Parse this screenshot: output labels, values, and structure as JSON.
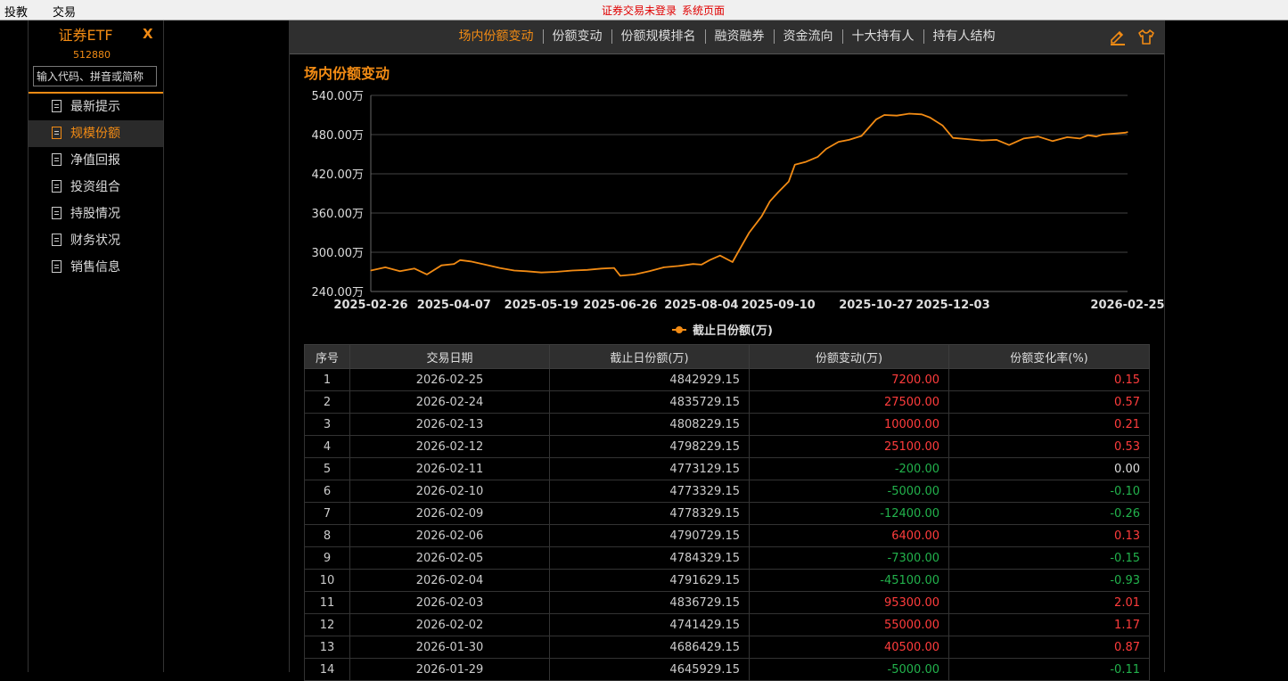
{
  "topbar": {
    "menus": [
      "投教",
      "交易"
    ],
    "status_login": "证券交易未登录",
    "status_page": "系统页面"
  },
  "sidebar": {
    "fund_name": "证券ETF",
    "close_label": "X",
    "fund_code": "512880",
    "search_placeholder": "输入代码、拼音或简称",
    "items": [
      {
        "label": "最新提示",
        "active": false
      },
      {
        "label": "规模份额",
        "active": true
      },
      {
        "label": "净值回报",
        "active": false
      },
      {
        "label": "投资组合",
        "active": false
      },
      {
        "label": "持股情况",
        "active": false
      },
      {
        "label": "财务状况",
        "active": false
      },
      {
        "label": "销售信息",
        "active": false
      }
    ]
  },
  "tabs": [
    {
      "label": "场内份额变动",
      "active": true
    },
    {
      "label": "份额变动",
      "active": false
    },
    {
      "label": "份额规模排名",
      "active": false
    },
    {
      "label": "融资融券",
      "active": false
    },
    {
      "label": "资金流向",
      "active": false
    },
    {
      "label": "十大持有人",
      "active": false
    },
    {
      "label": "持有人结构",
      "active": false
    }
  ],
  "section_title": "场内份额变动",
  "colors": {
    "accent": "#f28b14",
    "up": "#ff3c3c",
    "down": "#22b24c"
  },
  "chart_data": {
    "type": "line",
    "title": "",
    "ylim": [
      240,
      540
    ],
    "y_ticks": [
      "540.00万",
      "480.00万",
      "420.00万",
      "360.00万",
      "300.00万",
      "240.00万"
    ],
    "x_ticks": [
      "2025-02-26",
      "2025-04-07",
      "2025-05-19",
      "2025-06-26",
      "2025-08-04",
      "2025-09-10",
      "2025-10-27",
      "2025-12-03",
      "2026-02-25"
    ],
    "grid": true,
    "legend_position": "bottom",
    "series": [
      {
        "name": "截止日份额(万)",
        "color": "#f28b14",
        "points": [
          [
            "2025-02-26",
            272
          ],
          [
            "2025-03-05",
            277
          ],
          [
            "2025-03-12",
            271
          ],
          [
            "2025-03-19",
            275
          ],
          [
            "2025-03-25",
            266
          ],
          [
            "2025-04-01",
            280
          ],
          [
            "2025-04-07",
            282
          ],
          [
            "2025-04-10",
            288
          ],
          [
            "2025-04-15",
            286
          ],
          [
            "2025-04-22",
            281
          ],
          [
            "2025-04-29",
            276
          ],
          [
            "2025-05-06",
            272
          ],
          [
            "2025-05-12",
            271
          ],
          [
            "2025-05-19",
            269
          ],
          [
            "2025-05-26",
            270
          ],
          [
            "2025-06-03",
            272
          ],
          [
            "2025-06-10",
            273
          ],
          [
            "2025-06-17",
            275
          ],
          [
            "2025-06-23",
            276
          ],
          [
            "2025-06-26",
            264
          ],
          [
            "2025-07-03",
            266
          ],
          [
            "2025-07-10",
            271
          ],
          [
            "2025-07-17",
            277
          ],
          [
            "2025-07-24",
            279
          ],
          [
            "2025-07-31",
            282
          ],
          [
            "2025-08-04",
            281
          ],
          [
            "2025-08-08",
            288
          ],
          [
            "2025-08-13",
            295
          ],
          [
            "2025-08-19",
            285
          ],
          [
            "2025-08-22",
            302
          ],
          [
            "2025-08-27",
            330
          ],
          [
            "2025-09-02",
            355
          ],
          [
            "2025-09-06",
            378
          ],
          [
            "2025-09-10",
            392
          ],
          [
            "2025-09-15",
            408
          ],
          [
            "2025-09-18",
            434
          ],
          [
            "2025-09-23",
            438
          ],
          [
            "2025-09-29",
            446
          ],
          [
            "2025-10-03",
            458
          ],
          [
            "2025-10-09",
            469
          ],
          [
            "2025-10-14",
            472
          ],
          [
            "2025-10-20",
            478
          ],
          [
            "2025-10-27",
            503
          ],
          [
            "2025-10-31",
            510
          ],
          [
            "2025-11-06",
            509
          ],
          [
            "2025-11-12",
            512
          ],
          [
            "2025-11-18",
            511
          ],
          [
            "2025-11-22",
            506
          ],
          [
            "2025-11-28",
            494
          ],
          [
            "2025-12-03",
            475
          ],
          [
            "2025-12-10",
            473
          ],
          [
            "2025-12-17",
            471
          ],
          [
            "2025-12-24",
            472
          ],
          [
            "2025-12-30",
            464
          ],
          [
            "2026-01-06",
            474
          ],
          [
            "2026-01-13",
            477
          ],
          [
            "2026-01-20",
            470
          ],
          [
            "2026-01-27",
            476
          ],
          [
            "2026-02-02",
            474
          ],
          [
            "2026-02-06",
            479
          ],
          [
            "2026-02-10",
            477
          ],
          [
            "2026-02-12",
            479
          ],
          [
            "2026-02-13",
            480
          ],
          [
            "2026-02-24",
            483
          ],
          [
            "2026-02-25",
            484
          ]
        ]
      }
    ]
  },
  "table": {
    "headers": [
      "序号",
      "交易日期",
      "截止日份额(万)",
      "份额变动(万)",
      "份额变化率(%)"
    ],
    "rows": [
      {
        "no": "1",
        "date": "2026-02-25",
        "shares": "4842929.15",
        "change": "7200.00",
        "rate": "0.15",
        "dir": "up"
      },
      {
        "no": "2",
        "date": "2026-02-24",
        "shares": "4835729.15",
        "change": "27500.00",
        "rate": "0.57",
        "dir": "up"
      },
      {
        "no": "3",
        "date": "2026-02-13",
        "shares": "4808229.15",
        "change": "10000.00",
        "rate": "0.21",
        "dir": "up"
      },
      {
        "no": "4",
        "date": "2026-02-12",
        "shares": "4798229.15",
        "change": "25100.00",
        "rate": "0.53",
        "dir": "up"
      },
      {
        "no": "5",
        "date": "2026-02-11",
        "shares": "4773129.15",
        "change": "-200.00",
        "rate": "0.00",
        "dir": "down",
        "rate_dir": "flat"
      },
      {
        "no": "6",
        "date": "2026-02-10",
        "shares": "4773329.15",
        "change": "-5000.00",
        "rate": "-0.10",
        "dir": "down"
      },
      {
        "no": "7",
        "date": "2026-02-09",
        "shares": "4778329.15",
        "change": "-12400.00",
        "rate": "-0.26",
        "dir": "down"
      },
      {
        "no": "8",
        "date": "2026-02-06",
        "shares": "4790729.15",
        "change": "6400.00",
        "rate": "0.13",
        "dir": "up"
      },
      {
        "no": "9",
        "date": "2026-02-05",
        "shares": "4784329.15",
        "change": "-7300.00",
        "rate": "-0.15",
        "dir": "down"
      },
      {
        "no": "10",
        "date": "2026-02-04",
        "shares": "4791629.15",
        "change": "-45100.00",
        "rate": "-0.93",
        "dir": "down"
      },
      {
        "no": "11",
        "date": "2026-02-03",
        "shares": "4836729.15",
        "change": "95300.00",
        "rate": "2.01",
        "dir": "up"
      },
      {
        "no": "12",
        "date": "2026-02-02",
        "shares": "4741429.15",
        "change": "55000.00",
        "rate": "1.17",
        "dir": "up"
      },
      {
        "no": "13",
        "date": "2026-01-30",
        "shares": "4686429.15",
        "change": "40500.00",
        "rate": "0.87",
        "dir": "up"
      },
      {
        "no": "14",
        "date": "2026-01-29",
        "shares": "4645929.15",
        "change": "-5000.00",
        "rate": "-0.11",
        "dir": "down"
      }
    ]
  }
}
